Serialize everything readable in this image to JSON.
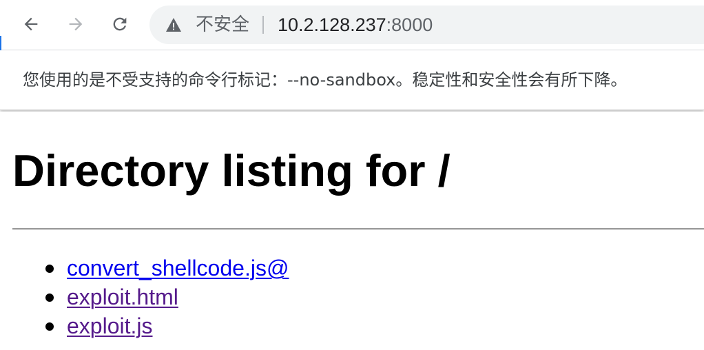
{
  "browser": {
    "back_icon": "arrow-left-icon",
    "forward_icon": "arrow-right-icon",
    "reload_icon": "reload-icon",
    "security_icon": "warning-triangle-icon",
    "security_label": "不安全",
    "url_host": "10.2.128.237",
    "url_port": ":8000"
  },
  "infobar": {
    "message": "您使用的是不受支持的命令行标记：--no-sandbox。稳定性和安全性会有所下降。"
  },
  "page": {
    "title": "Directory listing for /",
    "files": [
      {
        "name": "convert_shellcode.js@",
        "visited": false
      },
      {
        "name": "exploit.html",
        "visited": true
      },
      {
        "name": "exploit.js",
        "visited": true
      }
    ]
  },
  "colors": {
    "link": "#0000ee",
    "visited_link": "#551a8b",
    "omnibox_bg": "#f1f3f4"
  }
}
